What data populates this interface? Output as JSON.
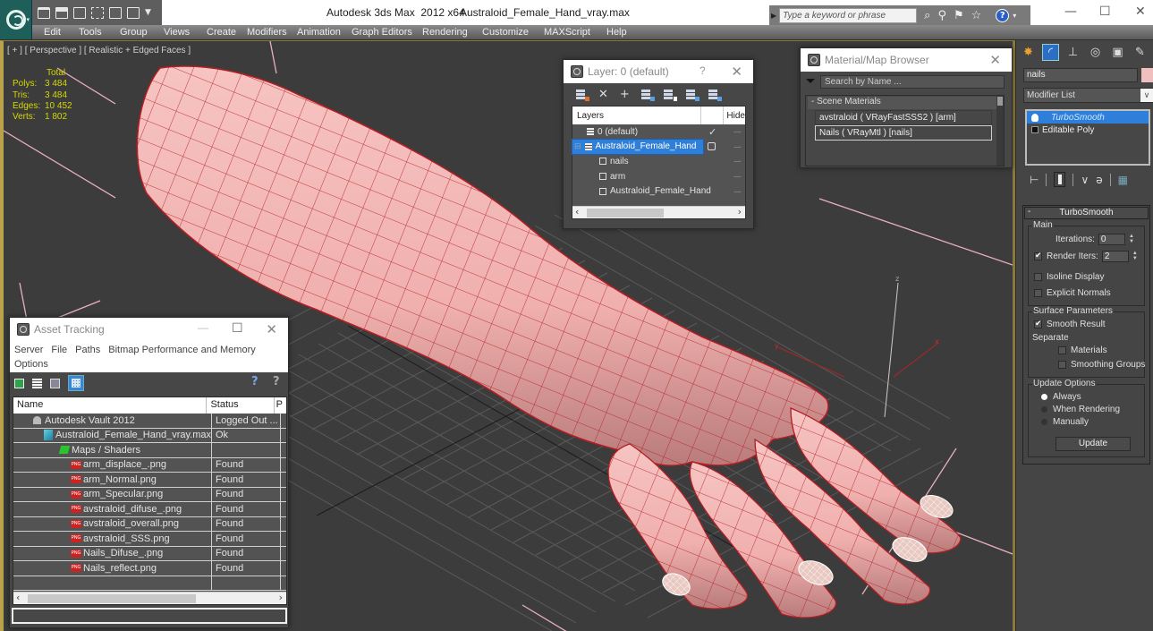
{
  "titlebar": {
    "app": "Autodesk 3ds Max  2012 x64",
    "file": "Australoid_Female_Hand_vray.max",
    "search_placeholder": "Type a keyword or phrase",
    "help_label": "?",
    "minimize": "—",
    "maximize": "☐",
    "close": "✕"
  },
  "menubar": [
    "Edit",
    "Tools",
    "Group",
    "Views",
    "Create",
    "Modifiers",
    "Animation",
    "Graph Editors",
    "Rendering",
    "Customize",
    "MAXScript",
    "Help"
  ],
  "viewport": {
    "label": "[ + ] [ Perspective ] [ Realistic + Edged Faces ]",
    "stats": {
      "header": "Total",
      "rows": [
        {
          "label": "Polys:",
          "value": "3 484"
        },
        {
          "label": "Tris:",
          "value": "3 484"
        },
        {
          "label": "Edges:",
          "value": "10 452"
        },
        {
          "label": "Verts:",
          "value": "1 802"
        }
      ]
    },
    "gizmo_labels": {
      "z": "z",
      "x": "x",
      "y": "y"
    },
    "mesh_color": "#f2b6b4",
    "wire_color": "#b41e24"
  },
  "layer_dialog": {
    "title": "Layer: 0 (default)",
    "help": "?",
    "close": "✕",
    "header": {
      "layers": "Layers",
      "hide": "Hide"
    },
    "rows": [
      {
        "name": "0 (default)",
        "type": "layer",
        "current": true
      },
      {
        "name": "Australoid_Female_Hand",
        "type": "layer",
        "selected": true
      },
      {
        "name": "nails",
        "type": "object"
      },
      {
        "name": "arm",
        "type": "object"
      },
      {
        "name": "Australoid_Female_Hand",
        "type": "object"
      }
    ],
    "hide_mark": "----"
  },
  "material_browser": {
    "title": "Material/Map Browser",
    "close": "✕",
    "search_placeholder": "Search by Name ...",
    "group": "- Scene Materials",
    "items": [
      {
        "label": "avstraloid  ( VRayFastSSS2 ) [arm]",
        "selected": false
      },
      {
        "label": "Nails  ( VRayMtl ) [nails]",
        "selected": true
      }
    ]
  },
  "asset_tracking": {
    "title": "Asset Tracking",
    "minimize": "—",
    "maximize": "☐",
    "close": "✕",
    "menu": [
      "Server",
      "File",
      "Paths",
      "Bitmap Performance and Memory",
      "Options"
    ],
    "columns": [
      "Name",
      "Status",
      "P"
    ],
    "rows": [
      {
        "name": "Autodesk Vault 2012",
        "status": "Logged Out ...",
        "icon": "vault",
        "indent": 1
      },
      {
        "name": "Australoid_Female_Hand_vray.max",
        "status": "Ok",
        "icon": "max",
        "indent": 2
      },
      {
        "name": "Maps / Shaders",
        "status": "",
        "icon": "maps",
        "indent": 3
      },
      {
        "name": "arm_displace_.png",
        "status": "Found",
        "icon": "png",
        "indent": 4
      },
      {
        "name": "arm_Normal.png",
        "status": "Found",
        "icon": "png",
        "indent": 4
      },
      {
        "name": "arm_Specular.png",
        "status": "Found",
        "icon": "png",
        "indent": 4
      },
      {
        "name": "avstraloid_difuse_.png",
        "status": "Found",
        "icon": "png",
        "indent": 4
      },
      {
        "name": "avstraloid_overall.png",
        "status": "Found",
        "icon": "png",
        "indent": 4
      },
      {
        "name": "avstraloid_SSS.png",
        "status": "Found",
        "icon": "png",
        "indent": 4
      },
      {
        "name": "Nails_Difuse_.png",
        "status": "Found",
        "icon": "png",
        "indent": 4
      },
      {
        "name": "Nails_reflect.png",
        "status": "Found",
        "icon": "png",
        "indent": 4
      }
    ]
  },
  "command_panel": {
    "object_name": "nails",
    "object_color": "#f0c0c0",
    "modifier_list": "Modifier List",
    "stack": [
      {
        "label": "TurboSmooth",
        "selected": true
      },
      {
        "label": "Editable Poly",
        "selected": false
      }
    ],
    "rollout": {
      "title": "TurboSmooth",
      "main_group": "Main",
      "iterations_label": "Iterations:",
      "iterations": "0",
      "render_iters_label": "Render Iters:",
      "render_iters": "2",
      "render_iters_checked": true,
      "isoline_label": "Isoline Display",
      "isoline_checked": false,
      "explicit_normals_label": "Explicit Normals",
      "explicit_normals_checked": false,
      "surface_group": "Surface Parameters",
      "smooth_result_label": "Smooth Result",
      "smooth_result_checked": true,
      "separate_label": "Separate",
      "materials_label": "Materials",
      "smoothing_groups_label": "Smoothing Groups",
      "update_group": "Update Options",
      "update_options": [
        {
          "label": "Always",
          "selected": true
        },
        {
          "label": "When Rendering",
          "selected": false
        },
        {
          "label": "Manually",
          "selected": false
        }
      ],
      "update_button": "Update"
    }
  }
}
